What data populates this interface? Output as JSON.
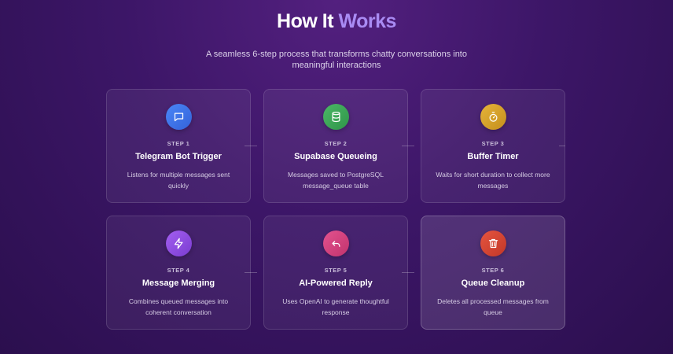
{
  "header": {
    "title_main": "How It",
    "title_accent": "Works",
    "subtitle": "A seamless 6-step process that transforms chatty conversations into meaningful interactions"
  },
  "steps": [
    {
      "step": "STEP 1",
      "title": "Telegram Bot Trigger",
      "desc": "Listens for multiple messages sent quickly",
      "icon": "chat-bubble-icon",
      "color": "#3f7af0"
    },
    {
      "step": "STEP 2",
      "title": "Supabase Queueing",
      "desc": "Messages saved to PostgreSQL message_queue table",
      "icon": "database-icon",
      "color": "#3ea75a"
    },
    {
      "step": "STEP 3",
      "title": "Buffer Timer",
      "desc": "Waits for short duration to collect more messages",
      "icon": "stopwatch-icon",
      "color": "#d9a52a"
    },
    {
      "step": "STEP 4",
      "title": "Message Merging",
      "desc": "Combines queued messages into coherent conversation",
      "icon": "lightning-icon",
      "color": "#8d4ee3"
    },
    {
      "step": "STEP 5",
      "title": "AI-Powered Reply",
      "desc": "Uses OpenAI to generate thoughtful response",
      "icon": "reply-arrow-icon",
      "color": "#d94381"
    },
    {
      "step": "STEP 6",
      "title": "Queue Cleanup",
      "desc": "Deletes all processed messages from queue",
      "icon": "trash-icon",
      "color": "#d8463a"
    }
  ]
}
